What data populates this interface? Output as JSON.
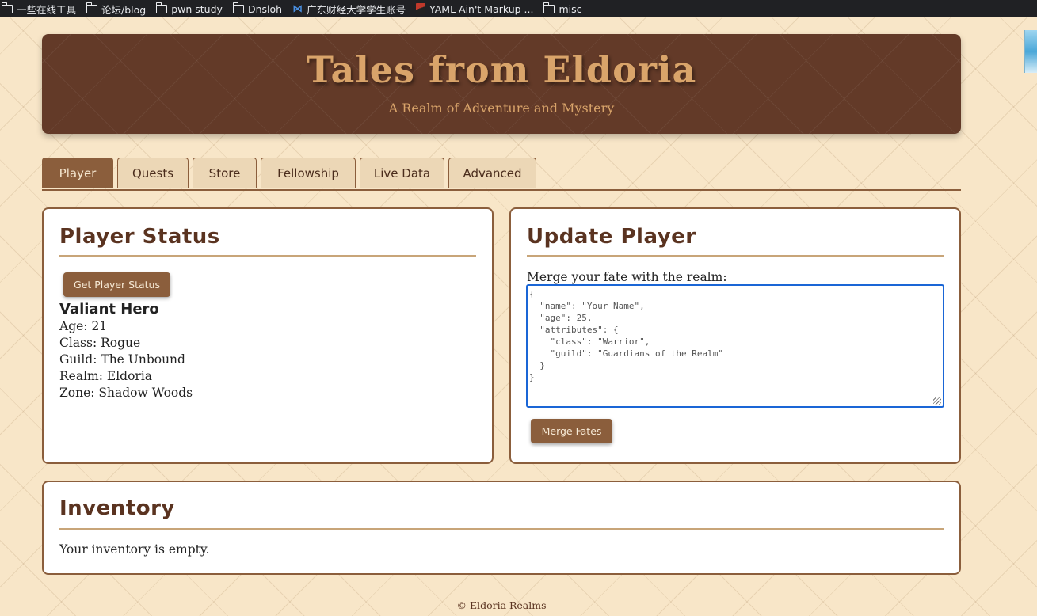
{
  "bookmarks": [
    {
      "label": "一些在线工具",
      "icon": "folder-icon"
    },
    {
      "label": "论坛/blog",
      "icon": "folder-icon"
    },
    {
      "label": "pwn study",
      "icon": "folder-icon"
    },
    {
      "label": "Dnsloh",
      "icon": "folder-icon"
    },
    {
      "label": "广东财经大学学生账号",
      "icon": "bowtie-icon"
    },
    {
      "label": "YAML Ain't Markup ...",
      "icon": "yaml-icon"
    },
    {
      "label": "misc",
      "icon": "folder-icon"
    }
  ],
  "header": {
    "title": "Tales from Eldoria",
    "subtitle": "A Realm of Adventure and Mystery"
  },
  "tabs": [
    {
      "label": "Player",
      "active": true
    },
    {
      "label": "Quests",
      "active": false
    },
    {
      "label": "Store",
      "active": false
    },
    {
      "label": "Fellowship",
      "active": false
    },
    {
      "label": "Live Data",
      "active": false
    },
    {
      "label": "Advanced",
      "active": false
    }
  ],
  "player_status": {
    "title": "Player Status",
    "button_label": "Get Player Status",
    "hero_name": "Valiant Hero",
    "lines": [
      "Age: 21",
      "Class: Rogue",
      "Guild: The Unbound",
      "Realm: Eldoria",
      "Zone: Shadow Woods"
    ]
  },
  "update_player": {
    "title": "Update Player",
    "label": "Merge your fate with the realm:",
    "json_value": "{\n  \"name\": \"Your Name\",\n  \"age\": 25,\n  \"attributes\": {\n    \"class\": \"Warrior\",\n    \"guild\": \"Guardians of the Realm\"\n  }\n}",
    "button_label": "Merge Fates"
  },
  "inventory": {
    "title": "Inventory",
    "empty_text": "Your inventory is empty."
  },
  "footer": {
    "text": "© Eldoria Realms"
  },
  "colors": {
    "background": "#f8e6c8",
    "header_bg": "#633a28",
    "accent": "#8b5e3c",
    "title_gold": "#d9a46a",
    "focus_blue": "#1a66d6"
  }
}
